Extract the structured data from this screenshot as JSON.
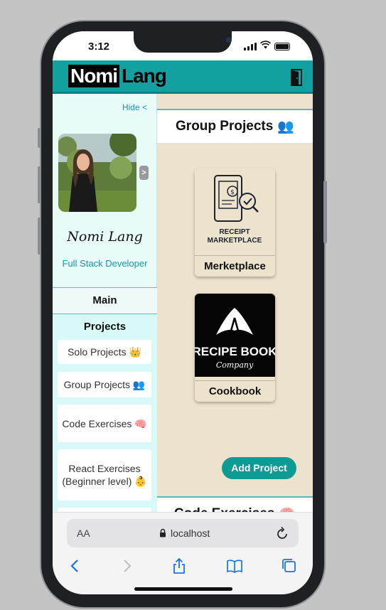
{
  "status_bar": {
    "time": "3:12"
  },
  "header": {
    "logo_part1": "Nomi",
    "logo_part2": "Lang"
  },
  "sidebar": {
    "hide_label": "Hide <",
    "expand_arrow": ">",
    "name": "Nomi Lang",
    "role": "Full Stack Developer",
    "main_label": "Main",
    "projects_label": "Projects",
    "items": [
      {
        "label": "Solo Projects 👑"
      },
      {
        "label": "Group Projects 👥"
      },
      {
        "label": "Code Exercises 🧠"
      },
      {
        "label": "React Exercises (Beginner level) 👶"
      }
    ]
  },
  "main": {
    "group_heading": "Group Projects",
    "group_emoji": "👥",
    "cards": [
      {
        "image_text_1": "RECEIPT",
        "image_text_2": "MARKETPLACE",
        "label": "Merketplace"
      },
      {
        "image_text_1": "RECIPE BOOK",
        "image_text_2": "Company",
        "label": "Cookbook"
      }
    ],
    "add_button": "Add Project",
    "code_heading": "Code Exercises",
    "code_emoji": "🧠"
  },
  "browser": {
    "text_size": "AA",
    "url": "localhost"
  },
  "colors": {
    "header": "#12a0a0",
    "main_bg": "#ede3cd",
    "sidebar_bg": "#e9fbf8",
    "button": "#0d9b94",
    "link": "#1199a6"
  }
}
